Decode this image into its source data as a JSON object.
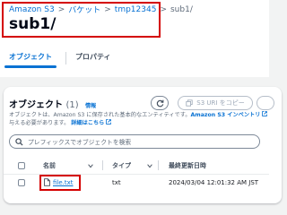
{
  "breadcrumb": {
    "items": [
      "Amazon S3",
      "バケット",
      "tmp12345"
    ],
    "current": "sub1/",
    "separator": ">"
  },
  "page": {
    "title": "sub1/"
  },
  "tabs": [
    {
      "label": "オブジェクト",
      "active": true
    },
    {
      "label": "プロパティ",
      "active": false
    }
  ],
  "objects": {
    "heading": "オブジェクト",
    "count": "(1)",
    "info": "情報",
    "buttons": {
      "copy_uri": "S3 URI をコピー"
    },
    "description": {
      "line1_prefix": "オブジェクトは、Amazon S3 に保存された基本的なエンティティです。",
      "line1_link": "Amazon S3 インベントリ",
      "line2_prefix": "与える必要があります。",
      "line2_link": "詳細はこちら"
    },
    "search": {
      "placeholder": "プレフィックスでオブジェクトを検索"
    },
    "columns": [
      "名前",
      "タイプ",
      "最終更新日時"
    ],
    "rows": [
      {
        "name": "file.txt",
        "type": "txt",
        "modified": "2024/03/04 12:01:32 AM JST"
      }
    ]
  },
  "colors": {
    "accent": "#0972d3",
    "highlight": "#d40000"
  }
}
